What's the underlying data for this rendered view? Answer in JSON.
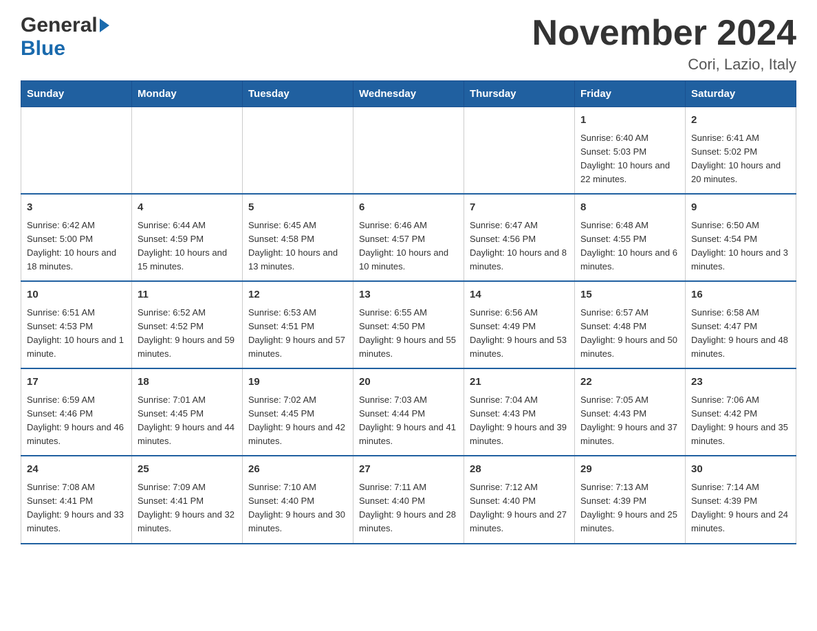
{
  "header": {
    "logo_general": "General",
    "logo_blue": "Blue",
    "month_title": "November 2024",
    "location": "Cori, Lazio, Italy"
  },
  "days_of_week": [
    "Sunday",
    "Monday",
    "Tuesday",
    "Wednesday",
    "Thursday",
    "Friday",
    "Saturday"
  ],
  "weeks": [
    [
      {
        "day": "",
        "info": ""
      },
      {
        "day": "",
        "info": ""
      },
      {
        "day": "",
        "info": ""
      },
      {
        "day": "",
        "info": ""
      },
      {
        "day": "",
        "info": ""
      },
      {
        "day": "1",
        "info": "Sunrise: 6:40 AM\nSunset: 5:03 PM\nDaylight: 10 hours and 22 minutes."
      },
      {
        "day": "2",
        "info": "Sunrise: 6:41 AM\nSunset: 5:02 PM\nDaylight: 10 hours and 20 minutes."
      }
    ],
    [
      {
        "day": "3",
        "info": "Sunrise: 6:42 AM\nSunset: 5:00 PM\nDaylight: 10 hours and 18 minutes."
      },
      {
        "day": "4",
        "info": "Sunrise: 6:44 AM\nSunset: 4:59 PM\nDaylight: 10 hours and 15 minutes."
      },
      {
        "day": "5",
        "info": "Sunrise: 6:45 AM\nSunset: 4:58 PM\nDaylight: 10 hours and 13 minutes."
      },
      {
        "day": "6",
        "info": "Sunrise: 6:46 AM\nSunset: 4:57 PM\nDaylight: 10 hours and 10 minutes."
      },
      {
        "day": "7",
        "info": "Sunrise: 6:47 AM\nSunset: 4:56 PM\nDaylight: 10 hours and 8 minutes."
      },
      {
        "day": "8",
        "info": "Sunrise: 6:48 AM\nSunset: 4:55 PM\nDaylight: 10 hours and 6 minutes."
      },
      {
        "day": "9",
        "info": "Sunrise: 6:50 AM\nSunset: 4:54 PM\nDaylight: 10 hours and 3 minutes."
      }
    ],
    [
      {
        "day": "10",
        "info": "Sunrise: 6:51 AM\nSunset: 4:53 PM\nDaylight: 10 hours and 1 minute."
      },
      {
        "day": "11",
        "info": "Sunrise: 6:52 AM\nSunset: 4:52 PM\nDaylight: 9 hours and 59 minutes."
      },
      {
        "day": "12",
        "info": "Sunrise: 6:53 AM\nSunset: 4:51 PM\nDaylight: 9 hours and 57 minutes."
      },
      {
        "day": "13",
        "info": "Sunrise: 6:55 AM\nSunset: 4:50 PM\nDaylight: 9 hours and 55 minutes."
      },
      {
        "day": "14",
        "info": "Sunrise: 6:56 AM\nSunset: 4:49 PM\nDaylight: 9 hours and 53 minutes."
      },
      {
        "day": "15",
        "info": "Sunrise: 6:57 AM\nSunset: 4:48 PM\nDaylight: 9 hours and 50 minutes."
      },
      {
        "day": "16",
        "info": "Sunrise: 6:58 AM\nSunset: 4:47 PM\nDaylight: 9 hours and 48 minutes."
      }
    ],
    [
      {
        "day": "17",
        "info": "Sunrise: 6:59 AM\nSunset: 4:46 PM\nDaylight: 9 hours and 46 minutes."
      },
      {
        "day": "18",
        "info": "Sunrise: 7:01 AM\nSunset: 4:45 PM\nDaylight: 9 hours and 44 minutes."
      },
      {
        "day": "19",
        "info": "Sunrise: 7:02 AM\nSunset: 4:45 PM\nDaylight: 9 hours and 42 minutes."
      },
      {
        "day": "20",
        "info": "Sunrise: 7:03 AM\nSunset: 4:44 PM\nDaylight: 9 hours and 41 minutes."
      },
      {
        "day": "21",
        "info": "Sunrise: 7:04 AM\nSunset: 4:43 PM\nDaylight: 9 hours and 39 minutes."
      },
      {
        "day": "22",
        "info": "Sunrise: 7:05 AM\nSunset: 4:43 PM\nDaylight: 9 hours and 37 minutes."
      },
      {
        "day": "23",
        "info": "Sunrise: 7:06 AM\nSunset: 4:42 PM\nDaylight: 9 hours and 35 minutes."
      }
    ],
    [
      {
        "day": "24",
        "info": "Sunrise: 7:08 AM\nSunset: 4:41 PM\nDaylight: 9 hours and 33 minutes."
      },
      {
        "day": "25",
        "info": "Sunrise: 7:09 AM\nSunset: 4:41 PM\nDaylight: 9 hours and 32 minutes."
      },
      {
        "day": "26",
        "info": "Sunrise: 7:10 AM\nSunset: 4:40 PM\nDaylight: 9 hours and 30 minutes."
      },
      {
        "day": "27",
        "info": "Sunrise: 7:11 AM\nSunset: 4:40 PM\nDaylight: 9 hours and 28 minutes."
      },
      {
        "day": "28",
        "info": "Sunrise: 7:12 AM\nSunset: 4:40 PM\nDaylight: 9 hours and 27 minutes."
      },
      {
        "day": "29",
        "info": "Sunrise: 7:13 AM\nSunset: 4:39 PM\nDaylight: 9 hours and 25 minutes."
      },
      {
        "day": "30",
        "info": "Sunrise: 7:14 AM\nSunset: 4:39 PM\nDaylight: 9 hours and 24 minutes."
      }
    ]
  ]
}
